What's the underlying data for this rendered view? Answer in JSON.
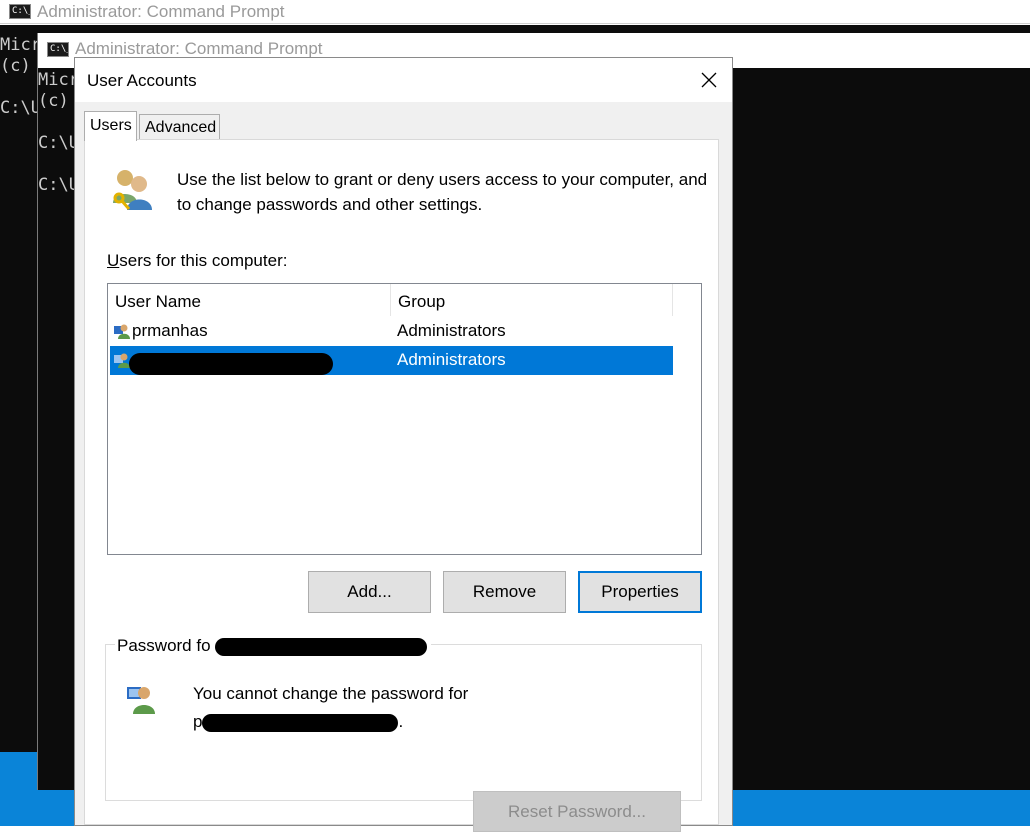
{
  "cmd_back": {
    "title": "Administrator: Command Prompt",
    "lines": [
      "Micr",
      "(c)",
      "",
      "C:\\U"
    ]
  },
  "cmd_front": {
    "title": "Administrator: Command Prompt",
    "lines": [
      "Micr",
      "(c)",
      "",
      "C:\\U",
      "",
      "C:\\U"
    ]
  },
  "dialog": {
    "title": "User Accounts",
    "tabs": [
      {
        "label": "Users",
        "active": true
      },
      {
        "label": "Advanced",
        "active": false
      }
    ],
    "intro_text": "Use the list below to grant or deny users access to your computer, and to change passwords and other settings.",
    "users_label_accel": "U",
    "users_label_rest": "sers for this computer:",
    "columns": [
      "User Name",
      "Group"
    ],
    "users": [
      {
        "name": "prmanhas",
        "group": "Administrators",
        "selected": false
      },
      {
        "name": "",
        "group": "Administrators",
        "selected": true
      }
    ],
    "buttons": {
      "add": "Add...",
      "remove": "Remove",
      "properties": "Properties"
    },
    "password_group_label": "Password fo",
    "password_message_line1": "You cannot change the password for",
    "password_message_line2_prefix": "p",
    "password_message_line2_suffix": ".",
    "reset_password": "Reset Password..."
  },
  "colors": {
    "selection": "#0078d7",
    "console_bg": "#0c0c0c",
    "desktop": "#0a84d8"
  }
}
